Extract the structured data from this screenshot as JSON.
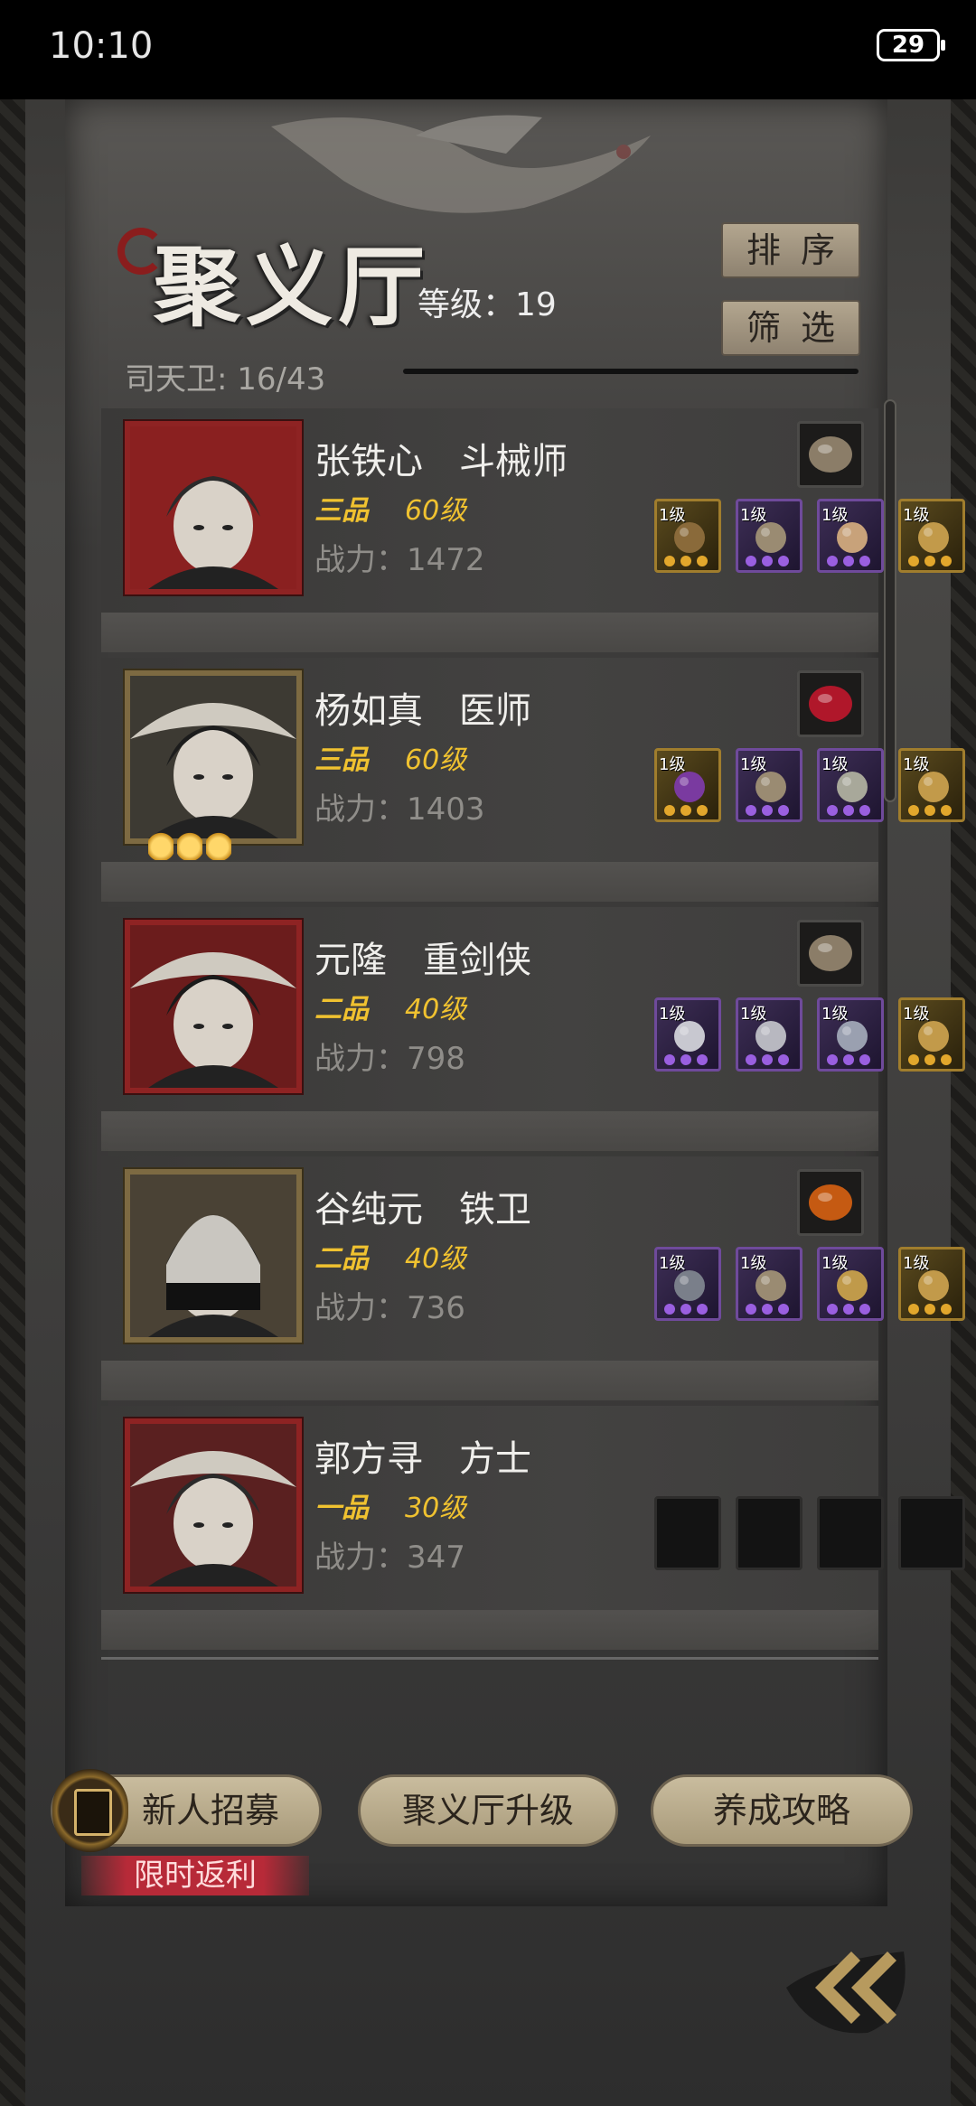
{
  "status": {
    "time": "10:10",
    "battery": "29"
  },
  "header": {
    "title": "聚义厅",
    "level_label": "等级：19",
    "guard_count": "司天卫: 16/43",
    "sort_label": "排序",
    "filter_label": "筛选"
  },
  "heroes": [
    {
      "name": "张铁心　斗械师",
      "rank": "三品",
      "level": "60级",
      "power": "战力：1472",
      "frame": "red",
      "accessory": "comb",
      "equipment": [
        {
          "lvl": "1级",
          "quality": "gold",
          "item": "crossbow-icon"
        },
        {
          "lvl": "1级",
          "quality": "purple",
          "item": "armor-icon"
        },
        {
          "lvl": "1级",
          "quality": "purple",
          "item": "claw-icon"
        },
        {
          "lvl": "1级",
          "quality": "gold",
          "item": "pouch-icon"
        }
      ]
    },
    {
      "name": "杨如真　医师",
      "rank": "三品",
      "level": "60级",
      "power": "战力：1403",
      "frame": "gold",
      "stars": 3,
      "accessory": "gem",
      "equipment": [
        {
          "lvl": "1级",
          "quality": "gold",
          "item": "gourd-icon"
        },
        {
          "lvl": "1级",
          "quality": "purple",
          "item": "armor-icon"
        },
        {
          "lvl": "1级",
          "quality": "purple",
          "item": "orb-icon"
        },
        {
          "lvl": "1级",
          "quality": "gold",
          "item": "pouch-icon"
        }
      ]
    },
    {
      "name": "元隆　重剑侠",
      "rank": "二品",
      "level": "40级",
      "power": "战力：798",
      "frame": "red",
      "accessory": "comb",
      "equipment": [
        {
          "lvl": "1级",
          "quality": "purple",
          "item": "sword-icon"
        },
        {
          "lvl": "1级",
          "quality": "purple",
          "item": "robe-icon"
        },
        {
          "lvl": "1级",
          "quality": "purple",
          "item": "gauntlet-icon"
        },
        {
          "lvl": "1级",
          "quality": "gold",
          "item": "pouch-icon"
        }
      ]
    },
    {
      "name": "谷纯元　铁卫",
      "rank": "二品",
      "level": "40级",
      "power": "战力：736",
      "frame": "gold",
      "accessory": "amber",
      "equipment": [
        {
          "lvl": "1级",
          "quality": "purple",
          "item": "mace-icon"
        },
        {
          "lvl": "1级",
          "quality": "purple",
          "item": "armor-icon"
        },
        {
          "lvl": "1级",
          "quality": "purple",
          "item": "ruyi-icon"
        },
        {
          "lvl": "1级",
          "quality": "gold",
          "item": "pouch-icon"
        }
      ]
    },
    {
      "name": "郭方寻　方士",
      "rank": "一品",
      "level": "30级",
      "power": "战力：347",
      "frame": "red",
      "accessory": "",
      "equipment": [
        {
          "lvl": "",
          "quality": "empty",
          "item": ""
        },
        {
          "lvl": "",
          "quality": "empty",
          "item": ""
        },
        {
          "lvl": "",
          "quality": "empty",
          "item": ""
        },
        {
          "lvl": "",
          "quality": "empty",
          "item": ""
        }
      ]
    }
  ],
  "footer": {
    "recruit_label": "新人招募",
    "limited_tag": "限时返利",
    "upgrade_label": "聚义厅升级",
    "guide_label": "养成攻略"
  },
  "colors": {
    "rank_gold": "#f0c230",
    "frame_red": "#8e2323",
    "frame_gold": "#7d6a42",
    "button_tan": "#c9bc9e"
  }
}
